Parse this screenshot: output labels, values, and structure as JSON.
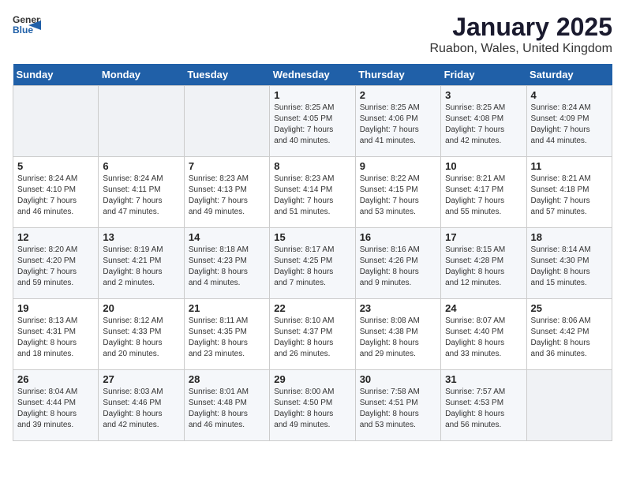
{
  "header": {
    "logo_general": "General",
    "logo_blue": "Blue",
    "title": "January 2025",
    "subtitle": "Ruabon, Wales, United Kingdom"
  },
  "days_of_week": [
    "Sunday",
    "Monday",
    "Tuesday",
    "Wednesday",
    "Thursday",
    "Friday",
    "Saturday"
  ],
  "weeks": [
    [
      {
        "day": "",
        "info": ""
      },
      {
        "day": "",
        "info": ""
      },
      {
        "day": "",
        "info": ""
      },
      {
        "day": "1",
        "info": "Sunrise: 8:25 AM\nSunset: 4:05 PM\nDaylight: 7 hours\nand 40 minutes."
      },
      {
        "day": "2",
        "info": "Sunrise: 8:25 AM\nSunset: 4:06 PM\nDaylight: 7 hours\nand 41 minutes."
      },
      {
        "day": "3",
        "info": "Sunrise: 8:25 AM\nSunset: 4:08 PM\nDaylight: 7 hours\nand 42 minutes."
      },
      {
        "day": "4",
        "info": "Sunrise: 8:24 AM\nSunset: 4:09 PM\nDaylight: 7 hours\nand 44 minutes."
      }
    ],
    [
      {
        "day": "5",
        "info": "Sunrise: 8:24 AM\nSunset: 4:10 PM\nDaylight: 7 hours\nand 46 minutes."
      },
      {
        "day": "6",
        "info": "Sunrise: 8:24 AM\nSunset: 4:11 PM\nDaylight: 7 hours\nand 47 minutes."
      },
      {
        "day": "7",
        "info": "Sunrise: 8:23 AM\nSunset: 4:13 PM\nDaylight: 7 hours\nand 49 minutes."
      },
      {
        "day": "8",
        "info": "Sunrise: 8:23 AM\nSunset: 4:14 PM\nDaylight: 7 hours\nand 51 minutes."
      },
      {
        "day": "9",
        "info": "Sunrise: 8:22 AM\nSunset: 4:15 PM\nDaylight: 7 hours\nand 53 minutes."
      },
      {
        "day": "10",
        "info": "Sunrise: 8:21 AM\nSunset: 4:17 PM\nDaylight: 7 hours\nand 55 minutes."
      },
      {
        "day": "11",
        "info": "Sunrise: 8:21 AM\nSunset: 4:18 PM\nDaylight: 7 hours\nand 57 minutes."
      }
    ],
    [
      {
        "day": "12",
        "info": "Sunrise: 8:20 AM\nSunset: 4:20 PM\nDaylight: 7 hours\nand 59 minutes."
      },
      {
        "day": "13",
        "info": "Sunrise: 8:19 AM\nSunset: 4:21 PM\nDaylight: 8 hours\nand 2 minutes."
      },
      {
        "day": "14",
        "info": "Sunrise: 8:18 AM\nSunset: 4:23 PM\nDaylight: 8 hours\nand 4 minutes."
      },
      {
        "day": "15",
        "info": "Sunrise: 8:17 AM\nSunset: 4:25 PM\nDaylight: 8 hours\nand 7 minutes."
      },
      {
        "day": "16",
        "info": "Sunrise: 8:16 AM\nSunset: 4:26 PM\nDaylight: 8 hours\nand 9 minutes."
      },
      {
        "day": "17",
        "info": "Sunrise: 8:15 AM\nSunset: 4:28 PM\nDaylight: 8 hours\nand 12 minutes."
      },
      {
        "day": "18",
        "info": "Sunrise: 8:14 AM\nSunset: 4:30 PM\nDaylight: 8 hours\nand 15 minutes."
      }
    ],
    [
      {
        "day": "19",
        "info": "Sunrise: 8:13 AM\nSunset: 4:31 PM\nDaylight: 8 hours\nand 18 minutes."
      },
      {
        "day": "20",
        "info": "Sunrise: 8:12 AM\nSunset: 4:33 PM\nDaylight: 8 hours\nand 20 minutes."
      },
      {
        "day": "21",
        "info": "Sunrise: 8:11 AM\nSunset: 4:35 PM\nDaylight: 8 hours\nand 23 minutes."
      },
      {
        "day": "22",
        "info": "Sunrise: 8:10 AM\nSunset: 4:37 PM\nDaylight: 8 hours\nand 26 minutes."
      },
      {
        "day": "23",
        "info": "Sunrise: 8:08 AM\nSunset: 4:38 PM\nDaylight: 8 hours\nand 29 minutes."
      },
      {
        "day": "24",
        "info": "Sunrise: 8:07 AM\nSunset: 4:40 PM\nDaylight: 8 hours\nand 33 minutes."
      },
      {
        "day": "25",
        "info": "Sunrise: 8:06 AM\nSunset: 4:42 PM\nDaylight: 8 hours\nand 36 minutes."
      }
    ],
    [
      {
        "day": "26",
        "info": "Sunrise: 8:04 AM\nSunset: 4:44 PM\nDaylight: 8 hours\nand 39 minutes."
      },
      {
        "day": "27",
        "info": "Sunrise: 8:03 AM\nSunset: 4:46 PM\nDaylight: 8 hours\nand 42 minutes."
      },
      {
        "day": "28",
        "info": "Sunrise: 8:01 AM\nSunset: 4:48 PM\nDaylight: 8 hours\nand 46 minutes."
      },
      {
        "day": "29",
        "info": "Sunrise: 8:00 AM\nSunset: 4:50 PM\nDaylight: 8 hours\nand 49 minutes."
      },
      {
        "day": "30",
        "info": "Sunrise: 7:58 AM\nSunset: 4:51 PM\nDaylight: 8 hours\nand 53 minutes."
      },
      {
        "day": "31",
        "info": "Sunrise: 7:57 AM\nSunset: 4:53 PM\nDaylight: 8 hours\nand 56 minutes."
      },
      {
        "day": "",
        "info": ""
      }
    ]
  ]
}
